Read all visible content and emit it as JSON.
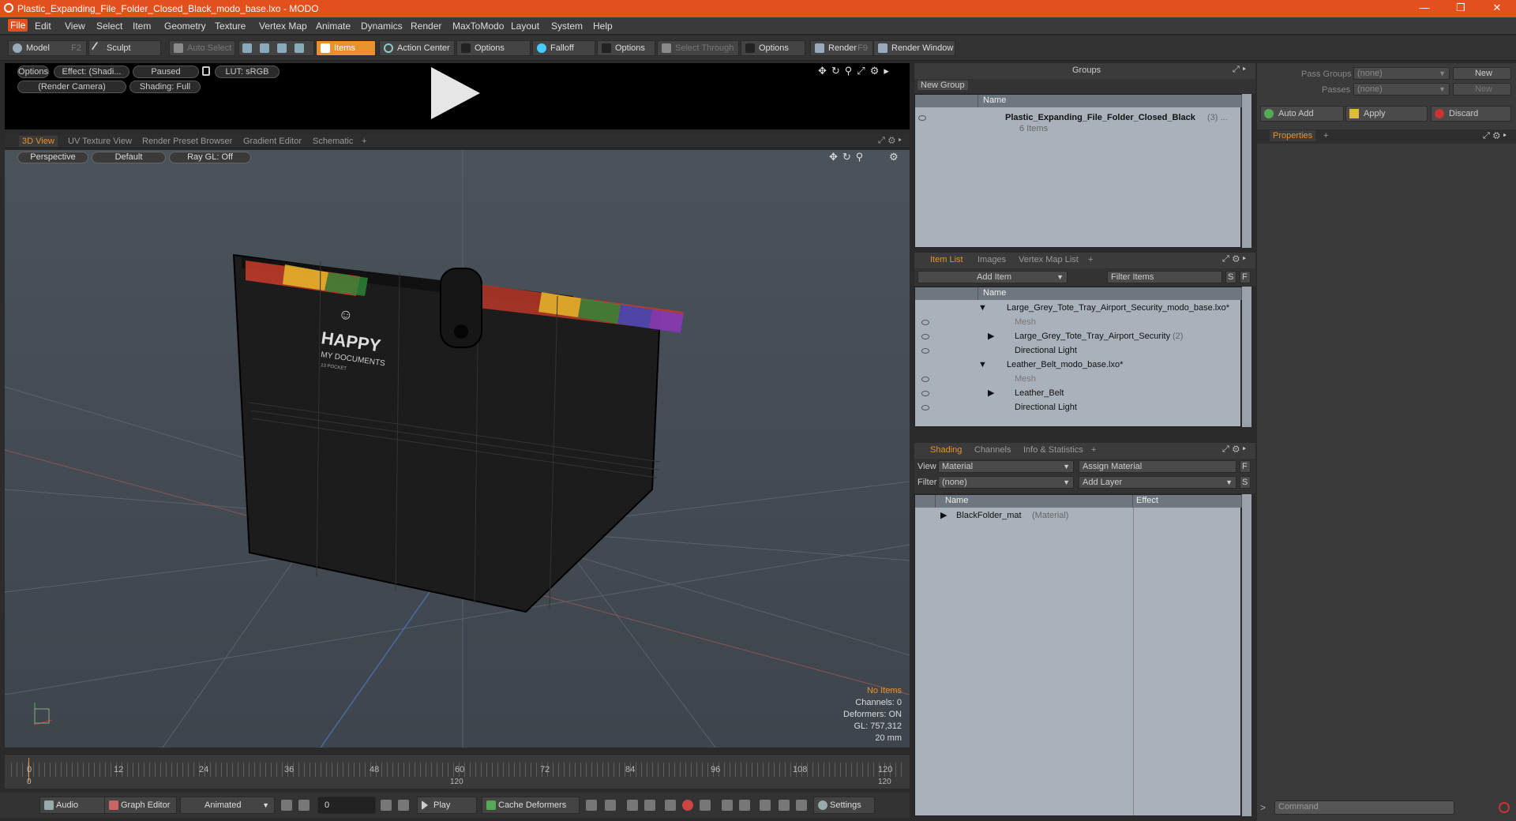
{
  "window": {
    "title": "Plastic_Expanding_File_Folder_Closed_Black_modo_base.lxo - MODO"
  },
  "menu": [
    "File",
    "Edit",
    "View",
    "Select",
    "Item",
    "Geometry",
    "Texture",
    "Vertex Map",
    "Animate",
    "Dynamics",
    "Render",
    "MaxToModo",
    "Layout",
    "System",
    "Help"
  ],
  "toolbar": {
    "model": "Model",
    "model_key": "F2",
    "sculpt": "Sculpt",
    "auto_select": "Auto Select",
    "items": "Items",
    "action_center": "Action Center",
    "options1": "Options",
    "falloff": "Falloff",
    "options2": "Options",
    "select_through": "Select Through",
    "options3": "Options",
    "render": "Render",
    "render_key": "F9",
    "render_window": "Render Window"
  },
  "preview": {
    "options": "Options",
    "effect": "Effect: (Shadi...",
    "paused": "Paused",
    "lut": "LUT: sRGB",
    "camera": "(Render Camera)",
    "shading": "Shading: Full"
  },
  "viewtabs": [
    "3D View",
    "UV Texture View",
    "Render Preset Browser",
    "Gradient Editor",
    "Schematic",
    "+"
  ],
  "viewport": {
    "perspective": "Perspective",
    "default": "Default",
    "raygl": "Ray GL: Off",
    "logo_text": "HAPPY",
    "logo_sub": "MY DOCUMENTS",
    "logo_small": "13 POCKET"
  },
  "stats": {
    "items": "No Items",
    "channels": "Channels: 0",
    "deformers": "Deformers: ON",
    "gl": "GL: 757,312",
    "scale": "20 mm"
  },
  "timeline": {
    "ticks": [
      "0",
      "12",
      "24",
      "36",
      "48",
      "60",
      "72",
      "84",
      "96",
      "108",
      "120"
    ],
    "ticks2": [
      "0",
      "120"
    ]
  },
  "bottombar": {
    "audio": "Audio",
    "graph": "Graph Editor",
    "animated": "Animated",
    "frame": "0",
    "play": "Play",
    "cache": "Cache Deformers",
    "settings": "Settings"
  },
  "groups": {
    "title": "Groups",
    "new_group": "New Group",
    "col_name": "Name",
    "item_name": "Plastic_Expanding_File_Folder_Closed_Black",
    "item_count": "(3) ...",
    "item_sub": "6 Items"
  },
  "itemlist": {
    "tabs": [
      "Item List",
      "Images",
      "Vertex Map List",
      "+"
    ],
    "add_item": "Add Item",
    "filter": "Filter Items",
    "s": "S",
    "f": "F",
    "col_name": "Name",
    "rows": [
      {
        "label": "Large_Grey_Tote_Tray_Airport_Security_modo_base.lxo*",
        "sub": ""
      },
      {
        "label": "Mesh",
        "sub": ""
      },
      {
        "label": "Large_Grey_Tote_Tray_Airport_Security",
        "sub": "(2)"
      },
      {
        "label": "Directional Light",
        "sub": ""
      },
      {
        "label": "Leather_Belt_modo_base.lxo*",
        "sub": ""
      },
      {
        "label": "Mesh",
        "sub": ""
      },
      {
        "label": "Leather_Belt",
        "sub": ""
      },
      {
        "label": "Directional Light",
        "sub": ""
      }
    ]
  },
  "shading": {
    "tabs": [
      "Shading",
      "Channels",
      "Info & Statistics",
      "+"
    ],
    "view_label": "View",
    "view_val": "Material",
    "assign": "Assign Material",
    "f": "F",
    "filter_label": "Filter",
    "filter_val": "(none)",
    "add_layer": "Add Layer",
    "s": "S",
    "col_name": "Name",
    "col_effect": "Effect",
    "row_name": "BlackFolder_mat",
    "row_type": "(Material)"
  },
  "right": {
    "pass_groups": "Pass Groups",
    "passes": "Passes",
    "none1": "(none)",
    "none2": "(none)",
    "new1": "New",
    "new2": "New",
    "auto_add": "Auto Add",
    "apply": "Apply",
    "discard": "Discard",
    "properties": "Properties",
    "plus": "+",
    "command": "Command"
  }
}
